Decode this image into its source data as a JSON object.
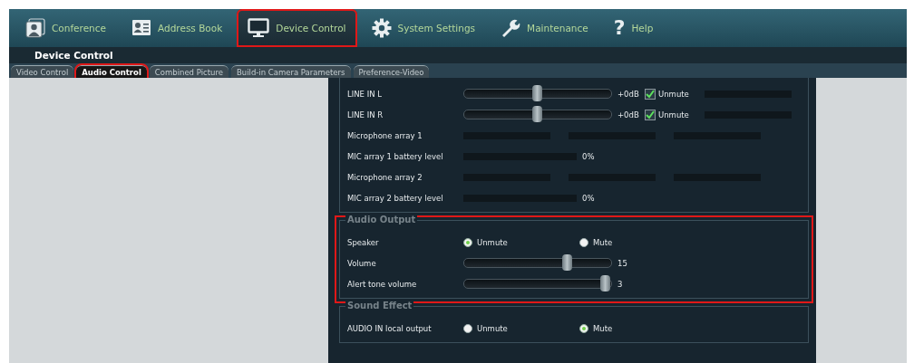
{
  "nav": [
    {
      "label": "Conference",
      "kind": "conference",
      "selected": false,
      "highlighted": false
    },
    {
      "label": "Address Book",
      "kind": "addressbook",
      "selected": false,
      "highlighted": false
    },
    {
      "label": "Device Control",
      "kind": "device",
      "selected": true,
      "highlighted": true
    },
    {
      "label": "System Settings",
      "kind": "settings",
      "selected": false,
      "highlighted": false
    },
    {
      "label": "Maintenance",
      "kind": "maintenance",
      "selected": false,
      "highlighted": false
    },
    {
      "label": "Help",
      "kind": "help",
      "glyph": "?",
      "selected": false,
      "highlighted": false
    }
  ],
  "page_title": "Device Control",
  "tabs": [
    {
      "label": "Video Control",
      "selected": false,
      "highlighted": false
    },
    {
      "label": "Audio Control",
      "selected": true,
      "highlighted": true
    },
    {
      "label": "Combined Picture",
      "selected": false,
      "highlighted": false
    },
    {
      "label": "Build-in Camera Parameters",
      "selected": false,
      "highlighted": false
    },
    {
      "label": "Preference-Video",
      "selected": false,
      "highlighted": false
    }
  ],
  "audio_input": {
    "rows": [
      {
        "kind": "slider",
        "label": "LINE IN L",
        "level": 0.5,
        "reading": "+0dB",
        "unmute": {
          "label": "Unmute",
          "checked": true
        }
      },
      {
        "kind": "slider",
        "label": "LINE IN R",
        "level": 0.5,
        "reading": "+0dB",
        "unmute": {
          "label": "Unmute",
          "checked": true
        }
      },
      {
        "kind": "meters",
        "label": "Microphone array 1"
      },
      {
        "kind": "battery",
        "label": "MIC array 1 battery level",
        "level": 0,
        "reading": "0%"
      },
      {
        "kind": "meters",
        "label": "Microphone array 2"
      },
      {
        "kind": "battery",
        "label": "MIC array 2 battery level",
        "level": 0,
        "reading": "0%"
      }
    ]
  },
  "audio_output": {
    "title": "Audio Output",
    "highlighted": true,
    "rows": [
      {
        "kind": "radio",
        "label": "Speaker",
        "options": [
          {
            "label": "Unmute",
            "selected": true
          },
          {
            "label": "Mute",
            "selected": false
          }
        ]
      },
      {
        "kind": "slider",
        "label": "Volume",
        "level": 0.72,
        "reading": "15"
      },
      {
        "kind": "slider",
        "label": "Alert tone volume",
        "level": 1,
        "reading": "3"
      }
    ]
  },
  "sound_effect": {
    "title": "Sound Effect",
    "rows": [
      {
        "kind": "radio",
        "label": "AUDIO IN local output",
        "options": [
          {
            "label": "Unmute",
            "selected": false
          },
          {
            "label": "Mute",
            "selected": true
          }
        ]
      }
    ]
  }
}
